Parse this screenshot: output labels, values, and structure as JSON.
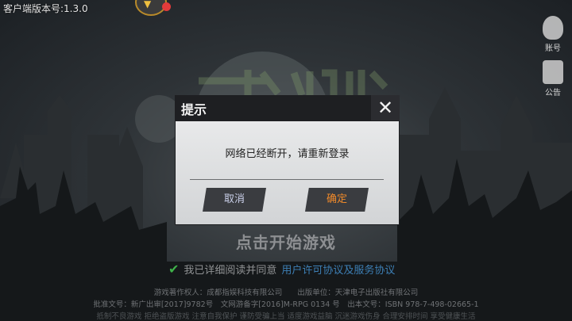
{
  "app": {
    "version_label": "客户端版本号:1.3.0"
  },
  "side_buttons": {
    "account_label": "账号",
    "notice_label": "公告"
  },
  "dialog": {
    "title": "提示",
    "close_glyph": "✕",
    "message": "网络已经断开，请重新登录",
    "cancel_label": "取消",
    "confirm_label": "确定"
  },
  "start": {
    "label": "点击开始游戏"
  },
  "agreement": {
    "check_glyph": "✔",
    "prefix": "我已详细阅读并同意",
    "link": "用户许可协议及服务协议"
  },
  "credits": {
    "line1": "游戏著作权人：成都指娱科技有限公司　　出版单位：天津电子出版社有限公司",
    "line2": "批准文号：新广出审[2017]9782号　文网游备字[2016]M-RPG 0134 号　出本文号：ISBN 978-7-498-02665-1",
    "line3": "抵制不良游戏 拒绝盗版游戏 注意自我保护 谨防受骗上当 适度游戏益脑 沉迷游戏伤身 合理安排时间 享受健康生活"
  },
  "colors": {
    "accent_orange": "#f08a2a",
    "cancel_text": "#c9cfe8",
    "check_green": "#3fb24a",
    "link_blue": "#3d7fb5",
    "notification_red": "#e23b3b"
  }
}
